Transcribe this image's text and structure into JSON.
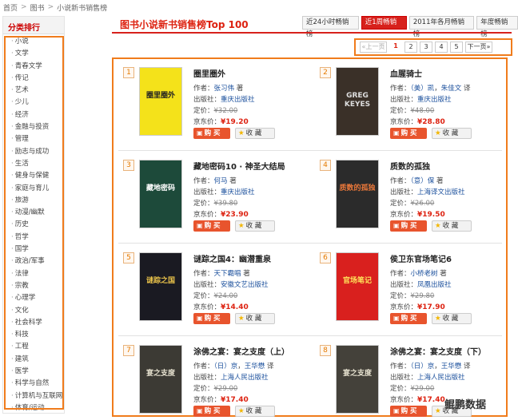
{
  "breadcrumb": [
    "首页",
    "图书",
    "小说新书销售榜"
  ],
  "sidebar": {
    "title": "分类排行",
    "items": [
      "小说",
      "文学",
      "青春文学",
      "传记",
      "艺术",
      "少儿",
      "经济",
      "金融与投资",
      "管理",
      "励志与成功",
      "生活",
      "健身与保健",
      "家庭与育儿",
      "旅游",
      "动漫/幽默",
      "历史",
      "哲学",
      "国学",
      "政治/军事",
      "法律",
      "宗教",
      "心理学",
      "文化",
      "社会科学",
      "科技",
      "工程",
      "建筑",
      "医学",
      "科学与自然",
      "计算机与互联网",
      "体育/运动"
    ]
  },
  "page_title": "图书小说新书销售榜Top 100",
  "tabs": [
    {
      "label": "近24小时畅销榜",
      "active": false
    },
    {
      "label": "近1周畅销榜",
      "active": true
    },
    {
      "label": "2011年各月畅销榜",
      "active": false
    },
    {
      "label": "年度畅销榜",
      "active": false
    }
  ],
  "pager": {
    "prev": "上一页",
    "pages": [
      "1",
      "2",
      "3",
      "4",
      "5"
    ],
    "current": "1",
    "next": "下一页"
  },
  "labels": {
    "author": "作者：",
    "publisher": "出版社：",
    "list_price": "定价：",
    "jd_price": "京东价：",
    "buy": "购 买",
    "fav": "收 藏"
  },
  "books": [
    {
      "rank": "1",
      "title": "圈里圈外",
      "author": "张习伟",
      "author_suffix": "著",
      "publisher": "重庆出版社",
      "list_price": "¥32.00",
      "jd_price": "¥19.20",
      "cover_bg": "#f4e21a",
      "cover_fg": "#222",
      "cover_text": "圈里圈外"
    },
    {
      "rank": "2",
      "title": "血腥骑士",
      "author": "（美）凯",
      "author2": "朱佳文",
      "author_suffix": "译",
      "publisher": "重庆出版社",
      "list_price": "¥48.00",
      "jd_price": "¥28.80",
      "cover_bg": "#3a3028",
      "cover_fg": "#ddd",
      "cover_text": "GREG KEYES"
    },
    {
      "rank": "3",
      "title": "藏地密码10 · 神圣大结局",
      "author": "何马",
      "author_suffix": "著",
      "publisher": "重庆出版社",
      "list_price": "¥39.80",
      "jd_price": "¥23.90",
      "cover_bg": "#1d4a3a",
      "cover_fg": "#fff",
      "cover_text": "藏地密码"
    },
    {
      "rank": "4",
      "title": "质数的孤独",
      "author": "（意）保",
      "author_suffix": "著",
      "publisher": "上海译文出版社",
      "list_price": "¥26.00",
      "jd_price": "¥19.50",
      "cover_bg": "#2b2b2b",
      "cover_fg": "#e8773a",
      "cover_text": "质数的孤独"
    },
    {
      "rank": "5",
      "title": "谜踪之国4：幽潜重泉",
      "author": "天下霸唱",
      "author_suffix": "著",
      "publisher": "安徽文艺出版社",
      "list_price": "¥24.00",
      "jd_price": "¥14.40",
      "cover_bg": "#1a1a22",
      "cover_fg": "#e9c24a",
      "cover_text": "谜踪之国"
    },
    {
      "rank": "6",
      "title": "侯卫东官场笔记6",
      "author": "小桥老树",
      "author_suffix": "著",
      "publisher": "凤凰出版社",
      "list_price": "¥29.80",
      "jd_price": "¥17.90",
      "cover_bg": "#d9201e",
      "cover_fg": "#ffe35a",
      "cover_text": "官场笔记"
    },
    {
      "rank": "7",
      "title": "涂佛之宴：宴之支度（上）",
      "author": "（日）京",
      "author2": "王华懋",
      "author_suffix": "译",
      "publisher": "上海人民出版社",
      "list_price": "¥29.00",
      "jd_price": "¥17.40",
      "cover_bg": "#3c3a34",
      "cover_fg": "#e6e1cf",
      "cover_text": "宴之支度"
    },
    {
      "rank": "8",
      "title": "涂佛之宴：宴之支度（下）",
      "author": "（日）京",
      "author2": "王华懋",
      "author_suffix": "译",
      "publisher": "上海人民出版社",
      "list_price": "¥29.00",
      "jd_price": "¥17.40",
      "cover_bg": "#44413a",
      "cover_fg": "#e6e1cf",
      "cover_text": "宴之支度"
    }
  ],
  "watermark": "鲲鹏数据"
}
